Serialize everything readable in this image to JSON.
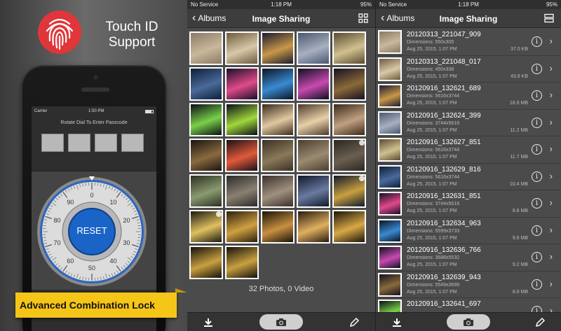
{
  "promo": {
    "title_line1": "Touch ID",
    "title_line2": "Support",
    "carrier": "Carrier",
    "time": "1:50 PM",
    "prompt": "Rotate Dial To Enter Passcode",
    "reset_label": "RESET",
    "dial_numbers": [
      "0",
      "10",
      "20",
      "30",
      "40",
      "50",
      "60",
      "70",
      "80",
      "90"
    ],
    "banner": "Advanced Combination Lock"
  },
  "grid_screen": {
    "carrier": "No Service",
    "time": "1:18 PM",
    "battery": "95%",
    "back_label": "Albums",
    "title": "Image Sharing",
    "count_text": "32 Photos, 0 Video",
    "thumb_colors": [
      [
        "#8a7a66",
        "#c9b89a"
      ],
      [
        "#6f5a3e",
        "#d8c8a8"
      ],
      [
        "#1c1a2e",
        "#c89848"
      ],
      [
        "#4a5870",
        "#a8b0c0"
      ],
      [
        "#5a4a30",
        "#d0c090"
      ],
      [
        "#0e1e3a",
        "#4a6a9a"
      ],
      [
        "#1a0e2a",
        "#e04a8a"
      ],
      [
        "#0a1426",
        "#3a8ad0"
      ],
      [
        "#0c1020",
        "#c84ab0"
      ],
      [
        "#141020",
        "#8a6a3a"
      ],
      [
        "#0a0e14",
        "#7ad04a"
      ],
      [
        "#0a0e18",
        "#a0d83a"
      ],
      [
        "#3a2a1a",
        "#e0c8a0"
      ],
      [
        "#4a3a2a",
        "#e8d0a8"
      ],
      [
        "#3a2a1a",
        "#c0a080"
      ],
      [
        "#1a1410",
        "#8a6a40"
      ],
      [
        "#1a1018",
        "#e05a3a"
      ],
      [
        "#3a3024",
        "#8a7a5a"
      ],
      [
        "#4a3e30",
        "#9a8a70"
      ],
      [
        "#2a2620",
        "#6a6050"
      ],
      [
        "#2a3020",
        "#8a9a70"
      ],
      [
        "#2a2a2a",
        "#8a8070"
      ],
      [
        "#3a3028",
        "#a09080"
      ],
      [
        "#10182a",
        "#6a7aa0"
      ],
      [
        "#10182a",
        "#c8a040"
      ],
      [
        "#1a1a12",
        "#e0c060"
      ],
      [
        "#2a2010",
        "#d0a040"
      ],
      [
        "#1a1208",
        "#c89040"
      ],
      [
        "#2a1a10",
        "#e0b060"
      ],
      [
        "#1a1408",
        "#d8a848"
      ],
      [
        "#14100a",
        "#c8a040"
      ],
      [
        "#14100a",
        "#c8a040"
      ]
    ]
  },
  "list_screen": {
    "carrier": "No Service",
    "time": "1:18 PM",
    "battery": "95%",
    "back_label": "Albums",
    "title": "Image Sharing",
    "rows": [
      {
        "name": "20120313_221047_909",
        "dims": "Dimensions: 550x305",
        "date": "Aug 25, 2015, 1:07 PM",
        "size": "37.0 KB",
        "c1": "#8a7a66",
        "c2": "#c9b89a"
      },
      {
        "name": "20120313_221048_017",
        "dims": "Dimensions: 450x338",
        "date": "Aug 25, 2015, 1:07 PM",
        "size": "43.9 KB",
        "c1": "#6f5a3e",
        "c2": "#d8c8a8"
      },
      {
        "name": "20120916_132621_689",
        "dims": "Dimensions: 5616x3744",
        "date": "Aug 25, 2015, 1:07 PM",
        "size": "16.9 MB",
        "c1": "#1c1a2e",
        "c2": "#c89848"
      },
      {
        "name": "20120916_132624_399",
        "dims": "Dimensions: 3744x5616",
        "date": "Aug 25, 2015, 1:07 PM",
        "size": "11.2 MB",
        "c1": "#4a5870",
        "c2": "#a8b0c0"
      },
      {
        "name": "20120916_132627_851",
        "dims": "Dimensions: 5616x3744",
        "date": "Aug 25, 2015, 1:07 PM",
        "size": "11.7 MB",
        "c1": "#5a4a30",
        "c2": "#d0c090"
      },
      {
        "name": "20120916_132629_816",
        "dims": "Dimensions: 5616x3744",
        "date": "Aug 25, 2015, 1:07 PM",
        "size": "10.4 MB",
        "c1": "#0e1e3a",
        "c2": "#4a6a9a"
      },
      {
        "name": "20120916_132631_851",
        "dims": "Dimensions: 3744x5616",
        "date": "Aug 25, 2015, 1:07 PM",
        "size": "8.8 MB",
        "c1": "#1a0e2a",
        "c2": "#e04a8a"
      },
      {
        "name": "20120916_132634_963",
        "dims": "Dimensions: 5599x3733",
        "date": "Aug 25, 2015, 1:07 PM",
        "size": "9.6 MB",
        "c1": "#0a1426",
        "c2": "#3a8ad0"
      },
      {
        "name": "20120916_132636_766",
        "dims": "Dimensions: 3688x5532",
        "date": "Aug 25, 2015, 1:07 PM",
        "size": "9.2 MB",
        "c1": "#0c1020",
        "c2": "#c84ab0"
      },
      {
        "name": "20120916_132639_943",
        "dims": "Dimensions: 5549x3699",
        "date": "Aug 25, 2015, 1:07 PM",
        "size": "8.9 MB",
        "c1": "#141020",
        "c2": "#8a6a3a"
      },
      {
        "name": "20120916_132641_697",
        "dims": "",
        "date": "",
        "size": "",
        "c1": "#0a0e14",
        "c2": "#7ad04a"
      }
    ]
  },
  "colors": {
    "accent_red": "#e0363a",
    "reset_blue": "#1a64c8",
    "banner_yellow": "#f5c518",
    "panel_bg": "#4b4b4b"
  },
  "icons": {
    "fingerprint": "fingerprint-icon",
    "grid_toggle": "grid-view-icon",
    "list_toggle": "list-view-icon",
    "download": "download-icon",
    "camera": "camera-icon",
    "edit": "pencil-icon",
    "info": "info-icon",
    "chevron": "chevron-right-icon"
  }
}
